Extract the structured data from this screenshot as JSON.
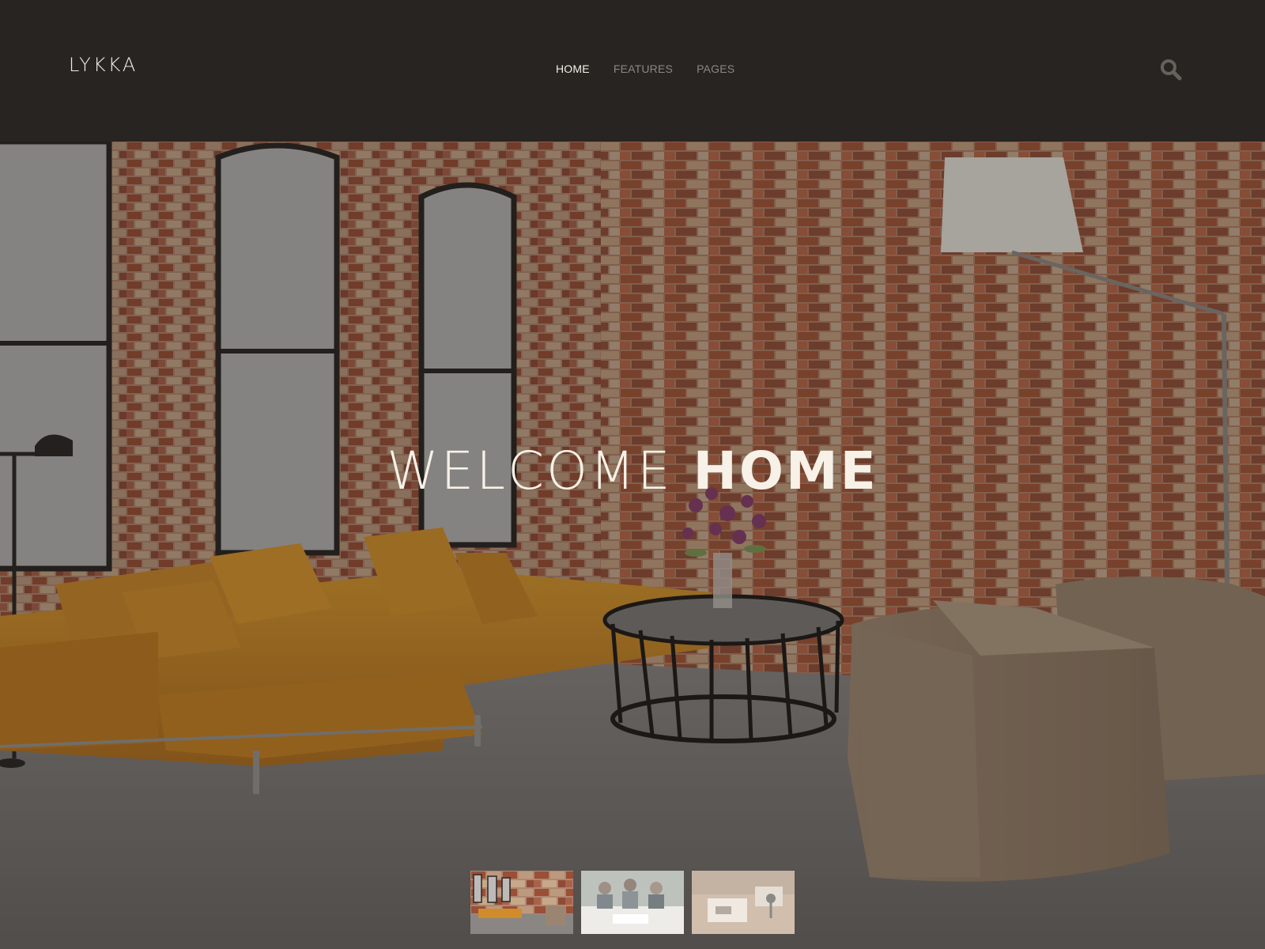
{
  "header": {
    "logo": "LYKKA",
    "nav": [
      {
        "label": "HOME",
        "active": true
      },
      {
        "label": "FEATURES",
        "active": false
      },
      {
        "label": "PAGES",
        "active": false
      }
    ],
    "search_icon": "search-icon"
  },
  "hero": {
    "title_light": "WELCOME",
    "title_bold": "HOME"
  },
  "thumbnails": [
    {
      "name": "loft-living-room",
      "active": true
    },
    {
      "name": "team-meeting",
      "active": false
    },
    {
      "name": "workspace-desk",
      "active": false
    }
  ],
  "colors": {
    "header_bg": "#282421",
    "nav_active": "#f5efe6",
    "nav_inactive": "#8d8780",
    "brick": "#9b5a3e",
    "sofa": "#c8862a",
    "pouf": "#a08a72"
  }
}
